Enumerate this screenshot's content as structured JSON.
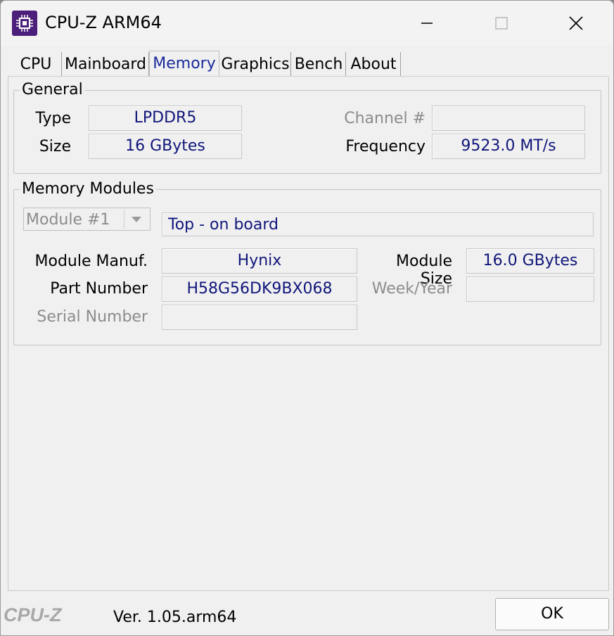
{
  "window": {
    "title": "CPU-Z ARM64"
  },
  "tabs": [
    {
      "label": "CPU"
    },
    {
      "label": "Mainboard"
    },
    {
      "label": "Memory"
    },
    {
      "label": "Graphics"
    },
    {
      "label": "Bench"
    },
    {
      "label": "About"
    }
  ],
  "active_tab": "Memory",
  "general": {
    "title": "General",
    "type_label": "Type",
    "type_value": "LPDDR5",
    "size_label": "Size",
    "size_value": "16 GBytes",
    "channel_label": "Channel #",
    "channel_value": "",
    "frequency_label": "Frequency",
    "frequency_value": "9523.0 MT/s"
  },
  "modules": {
    "title": "Memory Modules",
    "selected_module": "Module #1",
    "location_value": "Top - on board",
    "manuf_label": "Module Manuf.",
    "manuf_value": "Hynix",
    "module_size_label": "Module Size",
    "module_size_value": "16.0 GBytes",
    "part_label": "Part Number",
    "part_value": "H58G56DK9BX068",
    "week_label": "Week/Year",
    "week_value": "",
    "serial_label": "Serial Number",
    "serial_value": ""
  },
  "footer": {
    "logo": "CPU-Z",
    "version": "Ver. 1.05.arm64",
    "ok_label": "OK"
  },
  "colors": {
    "value_text": "#10167a",
    "active_tab": "#1a2a9a",
    "disabled": "#8c8c8c"
  },
  "icons": [
    "app-icon",
    "minimize-icon",
    "maximize-icon",
    "close-icon",
    "chevron-down-icon"
  ]
}
